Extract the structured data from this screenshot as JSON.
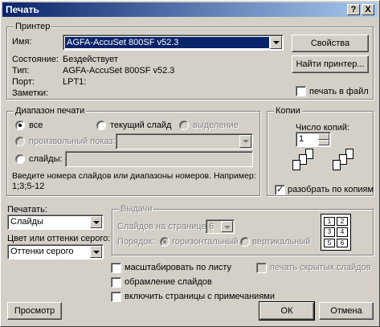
{
  "title": "Печать",
  "titlebar_buttons": {
    "help": "?",
    "close": "X"
  },
  "printer": {
    "group_label": "Принтер",
    "name_label": "Имя:",
    "name_value": "AGFA-AccuSet 800SF v52.3",
    "status_label": "Состояние:",
    "status_value": "Бездействует",
    "type_label": "Тип:",
    "type_value": "AGFA-AccuSet 800SF v52.3",
    "port_label": "Порт:",
    "port_value": "LPT1:",
    "notes_label": "Заметки:",
    "properties_button": "Свойства",
    "find_printer_button": "Найти принтер...",
    "print_to_file_label": "печать в файл",
    "print_to_file_checked": false
  },
  "range": {
    "group_label": "Диапазон печати",
    "all_label": "все",
    "current_slide_label": "текущий слайд",
    "selection_label": "выделение",
    "custom_show_label": "произвольный показ:",
    "slides_label": "слайды:",
    "selected": "all",
    "hint": "Введите номера слайдов или диапазоны номеров. Например:",
    "hint_example": "1;3;5-12",
    "slides_value": ""
  },
  "copies": {
    "group_label": "Копии",
    "count_label": "Число копий:",
    "count_value": "1",
    "collate_label": "разобрать по копиям",
    "collate_checked": true
  },
  "print_what": {
    "label": "Печатать:",
    "value": "Слайды"
  },
  "color": {
    "label": "Цвет или оттенки серого:",
    "value": "Оттенки серого"
  },
  "handouts": {
    "group_label": "Выдачи",
    "per_page_label": "Слайдов на странице:",
    "per_page_value": "6",
    "order_label": "Порядок:",
    "horizontal_label": "горизонтальный",
    "vertical_label": "вертикальный",
    "order_selected": "horizontal",
    "preview_pages": [
      "1",
      "2",
      "3",
      "4",
      "5",
      "6"
    ]
  },
  "options": {
    "scale_label": "масштабировать по листу",
    "frame_label": "обрамление слайдов",
    "comments_label": "включить страницы с примечаниями",
    "hidden_label": "печать скрытых слайдов"
  },
  "buttons": {
    "preview": "Просмотр",
    "ok": "ОК",
    "cancel": "Отмена"
  },
  "colors": {
    "title_start": "#0a246a",
    "title_end": "#a6caf0",
    "selection": "#0a246a"
  }
}
